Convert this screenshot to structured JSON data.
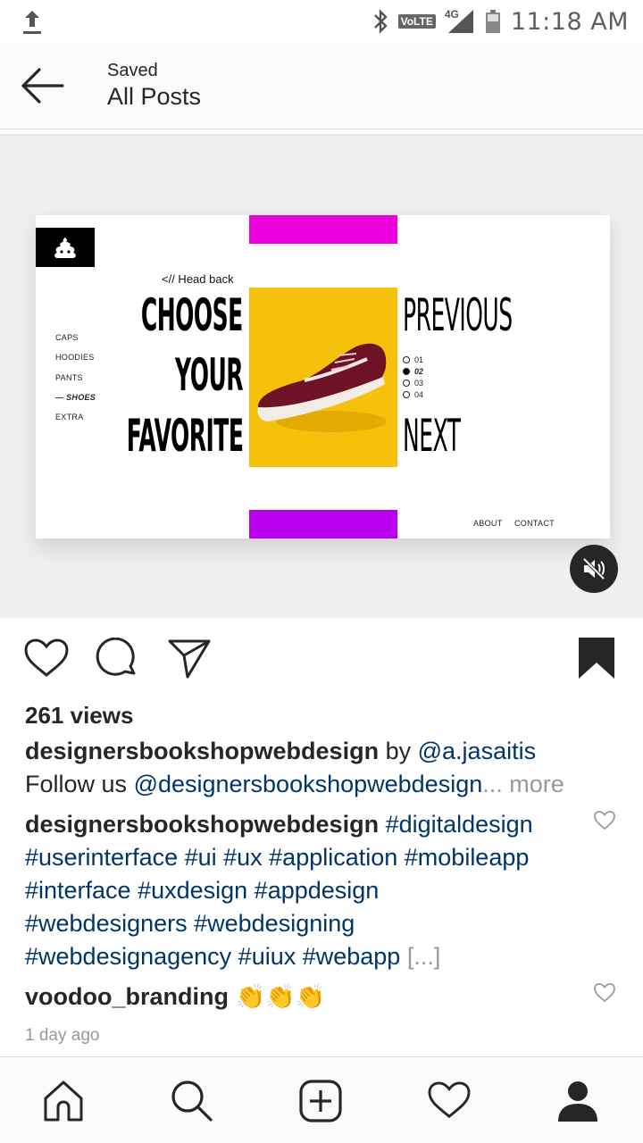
{
  "status_bar": {
    "time": "11:18 AM",
    "network_badge": "VoLTE",
    "network_type": "4G",
    "icons": [
      "upload-icon",
      "bluetooth-icon",
      "signal-icon",
      "battery-icon"
    ]
  },
  "header": {
    "subtitle": "Saved",
    "title": "All Posts"
  },
  "post_image": {
    "head_back": "<// Head back",
    "headline": [
      "CHOOSE",
      "YOUR",
      "FAVORITE"
    ],
    "previous": "PREVIOUS",
    "next": "NEXT",
    "menu": [
      "CAPS",
      "HOODIES",
      "PANTS",
      "— SHOES",
      "EXTRA"
    ],
    "active_menu_index": 3,
    "pager": [
      "01",
      "02",
      "03",
      "04"
    ],
    "active_pager_index": 1,
    "footer_links": [
      "ABOUT",
      "CONTACT"
    ],
    "colors": {
      "top_bar": "#ee00dd",
      "bottom_bar": "#b800ee",
      "panel": "#f6c10b"
    }
  },
  "post": {
    "views": "261 views",
    "author": "designersbookshopwebdesign",
    "by": "by",
    "credit": "@a.jasaitis",
    "follow_prefix": "Follow us",
    "follow_handle": "@designersbookshopwebdesign",
    "more": "... more",
    "comments": [
      {
        "user": "designersbookshopwebdesign",
        "lines": [
          "#digitaldesign",
          "#userinterface #ui #ux #application #mobileapp",
          "#interface #uxdesign #appdesign",
          "#webdesigners #webdesigning",
          "#webdesignagency #uiux #webapp"
        ],
        "truncated": "[...]"
      },
      {
        "user": "voodoo_branding",
        "text": "👏👏👏"
      }
    ],
    "time_ago": "1 day ago"
  },
  "colors": {
    "link": "#003569",
    "muted": "#999999",
    "text": "#262626"
  }
}
